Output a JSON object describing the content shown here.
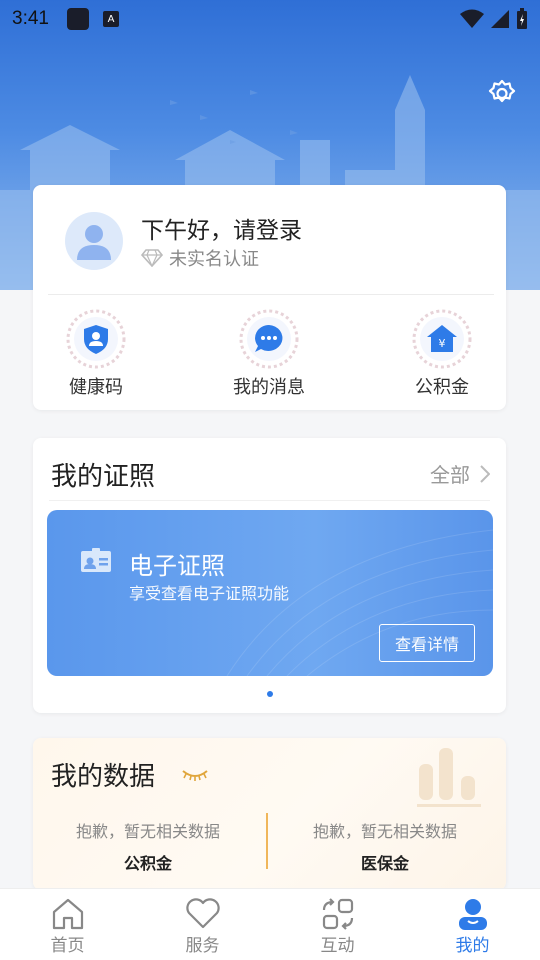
{
  "status_bar": {
    "time": "3:41",
    "badge": "A"
  },
  "user": {
    "greeting": "下午好，请登录",
    "verify_status": "未实名认证"
  },
  "quick_actions": [
    {
      "label": "健康码",
      "icon": "shield-user-icon"
    },
    {
      "label": "我的消息",
      "icon": "chat-bubble-icon"
    },
    {
      "label": "公积金",
      "icon": "house-yen-icon"
    }
  ],
  "certificates": {
    "title": "我的证照",
    "all_label": "全部",
    "banner_title": "电子证照",
    "banner_subtitle": "享受查看电子证照功能",
    "detail_button": "查看详情"
  },
  "my_data": {
    "title": "我的数据",
    "items": [
      {
        "message": "抱歉，暂无相关数据",
        "name": "公积金"
      },
      {
        "message": "抱歉，暂无相关数据",
        "name": "医保金"
      }
    ]
  },
  "nav": [
    {
      "label": "首页",
      "icon": "home-icon",
      "active": false
    },
    {
      "label": "服务",
      "icon": "heart-icon",
      "active": false
    },
    {
      "label": "互动",
      "icon": "interaction-icon",
      "active": false
    },
    {
      "label": "我的",
      "icon": "profile-icon",
      "active": true
    }
  ],
  "colors": {
    "accent": "#2e7be8",
    "banner": "#3b7cdc",
    "data_divider": "#f0b65a"
  }
}
